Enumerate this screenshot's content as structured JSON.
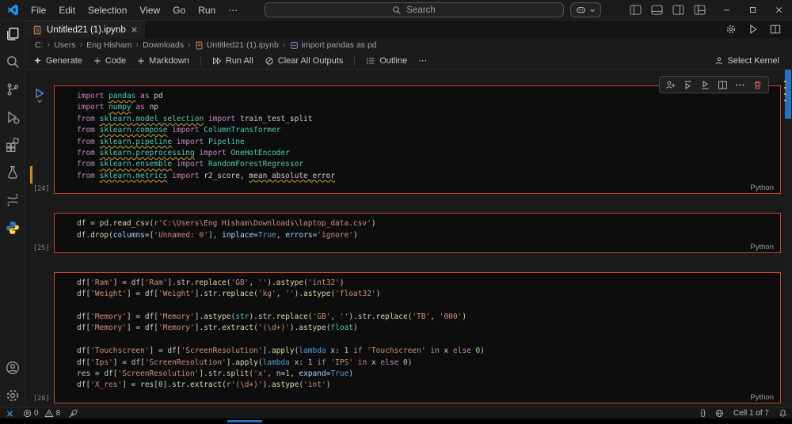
{
  "colors": {
    "cell_border": "#c7452e",
    "accent_blue": "#2472c8",
    "keyword": "#C586C0",
    "keyword_alt": "#569CD6",
    "string": "#CE9178",
    "function": "#DCDCAA",
    "number": "#B5CEA8",
    "type": "#4EC9B0",
    "variable": "#9CDCFE",
    "default_text": "#cccccc",
    "squiggle": "#c8a136",
    "python_blue": "#3b77a8",
    "python_yellow": "#ffd94a",
    "notebook_icon_orange": "#e8a14f",
    "remote_blue": "#3fa2f7",
    "run_button_blue": "#4fa3ff",
    "delete_icon_red": "#d1695d"
  },
  "titlebar": {
    "menus": [
      "File",
      "Edit",
      "Selection",
      "View",
      "Go",
      "Run",
      "⋯"
    ],
    "search_placeholder": "Search"
  },
  "tab": {
    "title": "Untitled21 (1).ipynb"
  },
  "breadcrumbs": [
    "C:",
    "Users",
    "Eng Hisham",
    "Downloads",
    "Untitled21 (1).ipynb",
    "import pandas as pd"
  ],
  "breadcrumb_separator": "›",
  "notebook_toolbar": {
    "generate": "Generate",
    "code": "Code",
    "markdown": "Markdown",
    "run_all": "Run All",
    "clear_all_outputs": "Clear All Outputs",
    "outline": "Outline",
    "more": "⋯",
    "select_kernel": "Select Kernel"
  },
  "cells": [
    {
      "exec": "[24]",
      "lang": "Python",
      "lines": [
        [
          [
            "k",
            "import"
          ],
          [
            "d",
            " "
          ],
          [
            "m",
            "pandas"
          ],
          [
            "d",
            " "
          ],
          [
            "k",
            "as"
          ],
          [
            "d",
            " pd"
          ]
        ],
        [
          [
            "k",
            "import"
          ],
          [
            "d",
            " "
          ],
          [
            "m",
            "numpy"
          ],
          [
            "d",
            " "
          ],
          [
            "k",
            "as"
          ],
          [
            "d",
            " np"
          ]
        ],
        [
          [
            "k",
            "from"
          ],
          [
            "d",
            " "
          ],
          [
            "m",
            "sklearn.model_selection"
          ],
          [
            "d",
            " "
          ],
          [
            "k",
            "import"
          ],
          [
            "d",
            " train_test_split"
          ]
        ],
        [
          [
            "k",
            "from"
          ],
          [
            "d",
            " "
          ],
          [
            "m",
            "sklearn.compose"
          ],
          [
            "d",
            " "
          ],
          [
            "k",
            "import"
          ],
          [
            "d",
            " "
          ],
          [
            "c",
            "ColumnTransformer"
          ]
        ],
        [
          [
            "k",
            "from"
          ],
          [
            "d",
            " "
          ],
          [
            "m",
            "sklearn.pipeline"
          ],
          [
            "d",
            " "
          ],
          [
            "k",
            "import"
          ],
          [
            "d",
            " "
          ],
          [
            "c",
            "Pipeline"
          ]
        ],
        [
          [
            "k",
            "from"
          ],
          [
            "d",
            " "
          ],
          [
            "m",
            "sklearn.preprocessing"
          ],
          [
            "d",
            " "
          ],
          [
            "k",
            "import"
          ],
          [
            "d",
            " "
          ],
          [
            "c",
            "OneHotEncoder"
          ]
        ],
        [
          [
            "k",
            "from"
          ],
          [
            "d",
            " "
          ],
          [
            "m",
            "sklearn.ensemble"
          ],
          [
            "d",
            " "
          ],
          [
            "k",
            "import"
          ],
          [
            "d",
            " "
          ],
          [
            "c",
            "RandomForestRegressor"
          ]
        ],
        [
          [
            "k",
            "from"
          ],
          [
            "d",
            " "
          ],
          [
            "m",
            "sklearn.metrics"
          ],
          [
            "d",
            " "
          ],
          [
            "k",
            "import"
          ],
          [
            "d",
            " r2_score, "
          ],
          [
            "u",
            "mean_absolute_error"
          ]
        ]
      ]
    },
    {
      "exec": "[25]",
      "lang": "Python",
      "lines": [
        [
          [
            "d",
            "df = pd."
          ],
          [
            "f",
            "read_csv"
          ],
          [
            "d",
            "("
          ],
          [
            "s",
            "r'C:\\Users\\Eng Hisham\\Downloads\\laptop_data.csv'"
          ],
          [
            "d",
            ")"
          ]
        ],
        [
          [
            "d",
            "df."
          ],
          [
            "f",
            "drop"
          ],
          [
            "d",
            "("
          ],
          [
            "v",
            "columns"
          ],
          [
            "d",
            "=["
          ],
          [
            "s",
            "'Unnamed: 0'"
          ],
          [
            "d",
            "], "
          ],
          [
            "v",
            "inplace"
          ],
          [
            "d",
            "="
          ],
          [
            "b",
            "True"
          ],
          [
            "d",
            ", "
          ],
          [
            "v",
            "errors"
          ],
          [
            "d",
            "="
          ],
          [
            "s",
            "'ignore'"
          ],
          [
            "d",
            ")"
          ]
        ]
      ]
    },
    {
      "exec": "[26]",
      "lang": "Python",
      "lines": [
        [
          [
            "d",
            "df["
          ],
          [
            "s",
            "'Ram'"
          ],
          [
            "d",
            "] = df["
          ],
          [
            "s",
            "'Ram'"
          ],
          [
            "d",
            "].str."
          ],
          [
            "f",
            "replace"
          ],
          [
            "d",
            "("
          ],
          [
            "s",
            "'GB'"
          ],
          [
            "d",
            ", "
          ],
          [
            "s",
            "''"
          ],
          [
            "d",
            ")."
          ],
          [
            "f",
            "astype"
          ],
          [
            "d",
            "("
          ],
          [
            "s",
            "'int32'"
          ],
          [
            "d",
            ")"
          ]
        ],
        [
          [
            "d",
            "df["
          ],
          [
            "s",
            "'Weight'"
          ],
          [
            "d",
            "] = df["
          ],
          [
            "s",
            "'Weight'"
          ],
          [
            "d",
            "].str."
          ],
          [
            "f",
            "replace"
          ],
          [
            "d",
            "("
          ],
          [
            "s",
            "'kg'"
          ],
          [
            "d",
            ", "
          ],
          [
            "s",
            "''"
          ],
          [
            "d",
            ")."
          ],
          [
            "f",
            "astype"
          ],
          [
            "d",
            "("
          ],
          [
            "s",
            "'float32'"
          ],
          [
            "d",
            ")"
          ]
        ],
        [],
        [
          [
            "d",
            "df["
          ],
          [
            "s",
            "'Memory'"
          ],
          [
            "d",
            "] = df["
          ],
          [
            "s",
            "'Memory'"
          ],
          [
            "d",
            "]."
          ],
          [
            "f",
            "astype"
          ],
          [
            "d",
            "("
          ],
          [
            "t",
            "str"
          ],
          [
            "d",
            ").str."
          ],
          [
            "f",
            "replace"
          ],
          [
            "d",
            "("
          ],
          [
            "s",
            "'GB'"
          ],
          [
            "d",
            ", "
          ],
          [
            "s",
            "''"
          ],
          [
            "d",
            ").str."
          ],
          [
            "f",
            "replace"
          ],
          [
            "d",
            "("
          ],
          [
            "s",
            "'TB'"
          ],
          [
            "d",
            ", "
          ],
          [
            "s",
            "'000'"
          ],
          [
            "d",
            ")"
          ]
        ],
        [
          [
            "d",
            "df["
          ],
          [
            "s",
            "'Memory'"
          ],
          [
            "d",
            "] = df["
          ],
          [
            "s",
            "'Memory'"
          ],
          [
            "d",
            "].str."
          ],
          [
            "f",
            "extract"
          ],
          [
            "d",
            "("
          ],
          [
            "s",
            "'(\\d+)'"
          ],
          [
            "d",
            ")."
          ],
          [
            "f",
            "astype"
          ],
          [
            "d",
            "("
          ],
          [
            "t",
            "float"
          ],
          [
            "d",
            ")"
          ]
        ],
        [],
        [
          [
            "d",
            "df["
          ],
          [
            "s",
            "'Touchscreen'"
          ],
          [
            "d",
            "] = df["
          ],
          [
            "s",
            "'ScreenResolution'"
          ],
          [
            "d",
            "]."
          ],
          [
            "f",
            "apply"
          ],
          [
            "d",
            "("
          ],
          [
            "kb",
            "lambda"
          ],
          [
            "d",
            " x: "
          ],
          [
            "n",
            "1"
          ],
          [
            "d",
            " "
          ],
          [
            "k",
            "if"
          ],
          [
            "d",
            " "
          ],
          [
            "s",
            "'Touchscreen'"
          ],
          [
            "d",
            " "
          ],
          [
            "k",
            "in"
          ],
          [
            "d",
            " x "
          ],
          [
            "k",
            "else"
          ],
          [
            "d",
            " "
          ],
          [
            "n",
            "0"
          ],
          [
            "d",
            ")"
          ]
        ],
        [
          [
            "d",
            "df["
          ],
          [
            "s",
            "'Ips'"
          ],
          [
            "d",
            "] = df["
          ],
          [
            "s",
            "'ScreenResolution'"
          ],
          [
            "d",
            "]."
          ],
          [
            "f",
            "apply"
          ],
          [
            "d",
            "("
          ],
          [
            "kb",
            "lambda"
          ],
          [
            "d",
            " x: "
          ],
          [
            "n",
            "1"
          ],
          [
            "d",
            " "
          ],
          [
            "k",
            "if"
          ],
          [
            "d",
            " "
          ],
          [
            "s",
            "'IPS'"
          ],
          [
            "d",
            " "
          ],
          [
            "k",
            "in"
          ],
          [
            "d",
            " x "
          ],
          [
            "k",
            "else"
          ],
          [
            "d",
            " "
          ],
          [
            "n",
            "0"
          ],
          [
            "d",
            ")"
          ]
        ],
        [
          [
            "d",
            "res = df["
          ],
          [
            "s",
            "'ScreenResolution'"
          ],
          [
            "d",
            "].str."
          ],
          [
            "f",
            "split"
          ],
          [
            "d",
            "("
          ],
          [
            "s",
            "'x'"
          ],
          [
            "d",
            ", "
          ],
          [
            "v",
            "n"
          ],
          [
            "d",
            "="
          ],
          [
            "n",
            "1"
          ],
          [
            "d",
            ", "
          ],
          [
            "v",
            "expand"
          ],
          [
            "d",
            "="
          ],
          [
            "b",
            "True"
          ],
          [
            "d",
            ")"
          ]
        ],
        [
          [
            "d",
            "df["
          ],
          [
            "s",
            "'X_res'"
          ],
          [
            "d",
            "] = res["
          ],
          [
            "n",
            "0"
          ],
          [
            "d",
            "].str."
          ],
          [
            "f",
            "extract"
          ],
          [
            "d",
            "("
          ],
          [
            "s",
            "r'(\\d+)'"
          ],
          [
            "d",
            ")."
          ],
          [
            "f",
            "astype"
          ],
          [
            "d",
            "("
          ],
          [
            "s",
            "'int'"
          ],
          [
            "d",
            ")"
          ]
        ]
      ]
    }
  ],
  "statusbar": {
    "errors": "0",
    "warnings": "8",
    "braces": "{}",
    "cell_indicator": "Cell 1 of 7"
  }
}
